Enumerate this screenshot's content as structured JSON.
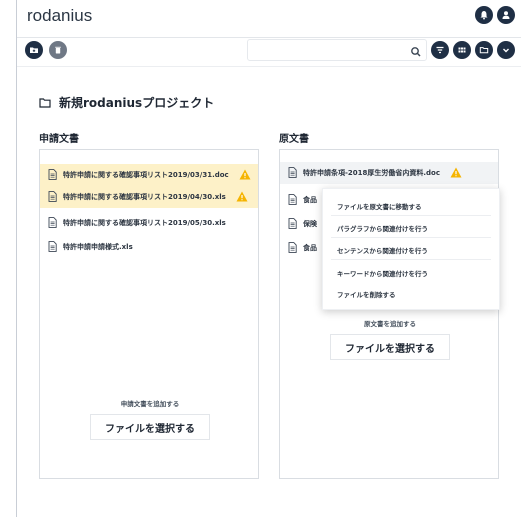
{
  "app": {
    "title": "rodanius"
  },
  "search": {
    "value": ""
  },
  "project": {
    "name": "新規rodaniusプロジェクト"
  },
  "left_panel": {
    "label": "申請文書",
    "files": [
      {
        "name": "特許申請に関する確認事項リスト2019/03/31.doc",
        "highlighted": true,
        "warning": true
      },
      {
        "name": "特許申請に関する確認事項リスト2019/04/30.xls",
        "highlighted": true,
        "warning": true
      },
      {
        "name": "特許申請に関する確認事項リスト2019/05/30.xls",
        "highlighted": false,
        "warning": false
      },
      {
        "name": "特許申請申請様式.xls",
        "highlighted": false,
        "warning": false
      }
    ],
    "add_text": "申請文書を追加する",
    "select_button": "ファイルを選択する"
  },
  "right_panel": {
    "label": "原文書",
    "files": [
      {
        "name": "特許申請条項-2018厚生労働省内資料.doc",
        "warning": true
      },
      {
        "name": "食品",
        "warning": false
      },
      {
        "name": "保険",
        "warning": false
      },
      {
        "name": "食品",
        "warning": false
      }
    ],
    "add_text": "原文書を追加する",
    "select_button": "ファイルを選択する"
  },
  "context_menu": {
    "items": [
      "ファイルを原文書に移動する",
      "パラグラフから関連付けを行う",
      "センテンスから関連付けを行う",
      "キーワードから関連付けを行う",
      "ファイルを削除する"
    ]
  },
  "colors": {
    "accent": "#1f2f45",
    "highlight": "#fdf1c8",
    "warning": "#f5b400"
  }
}
